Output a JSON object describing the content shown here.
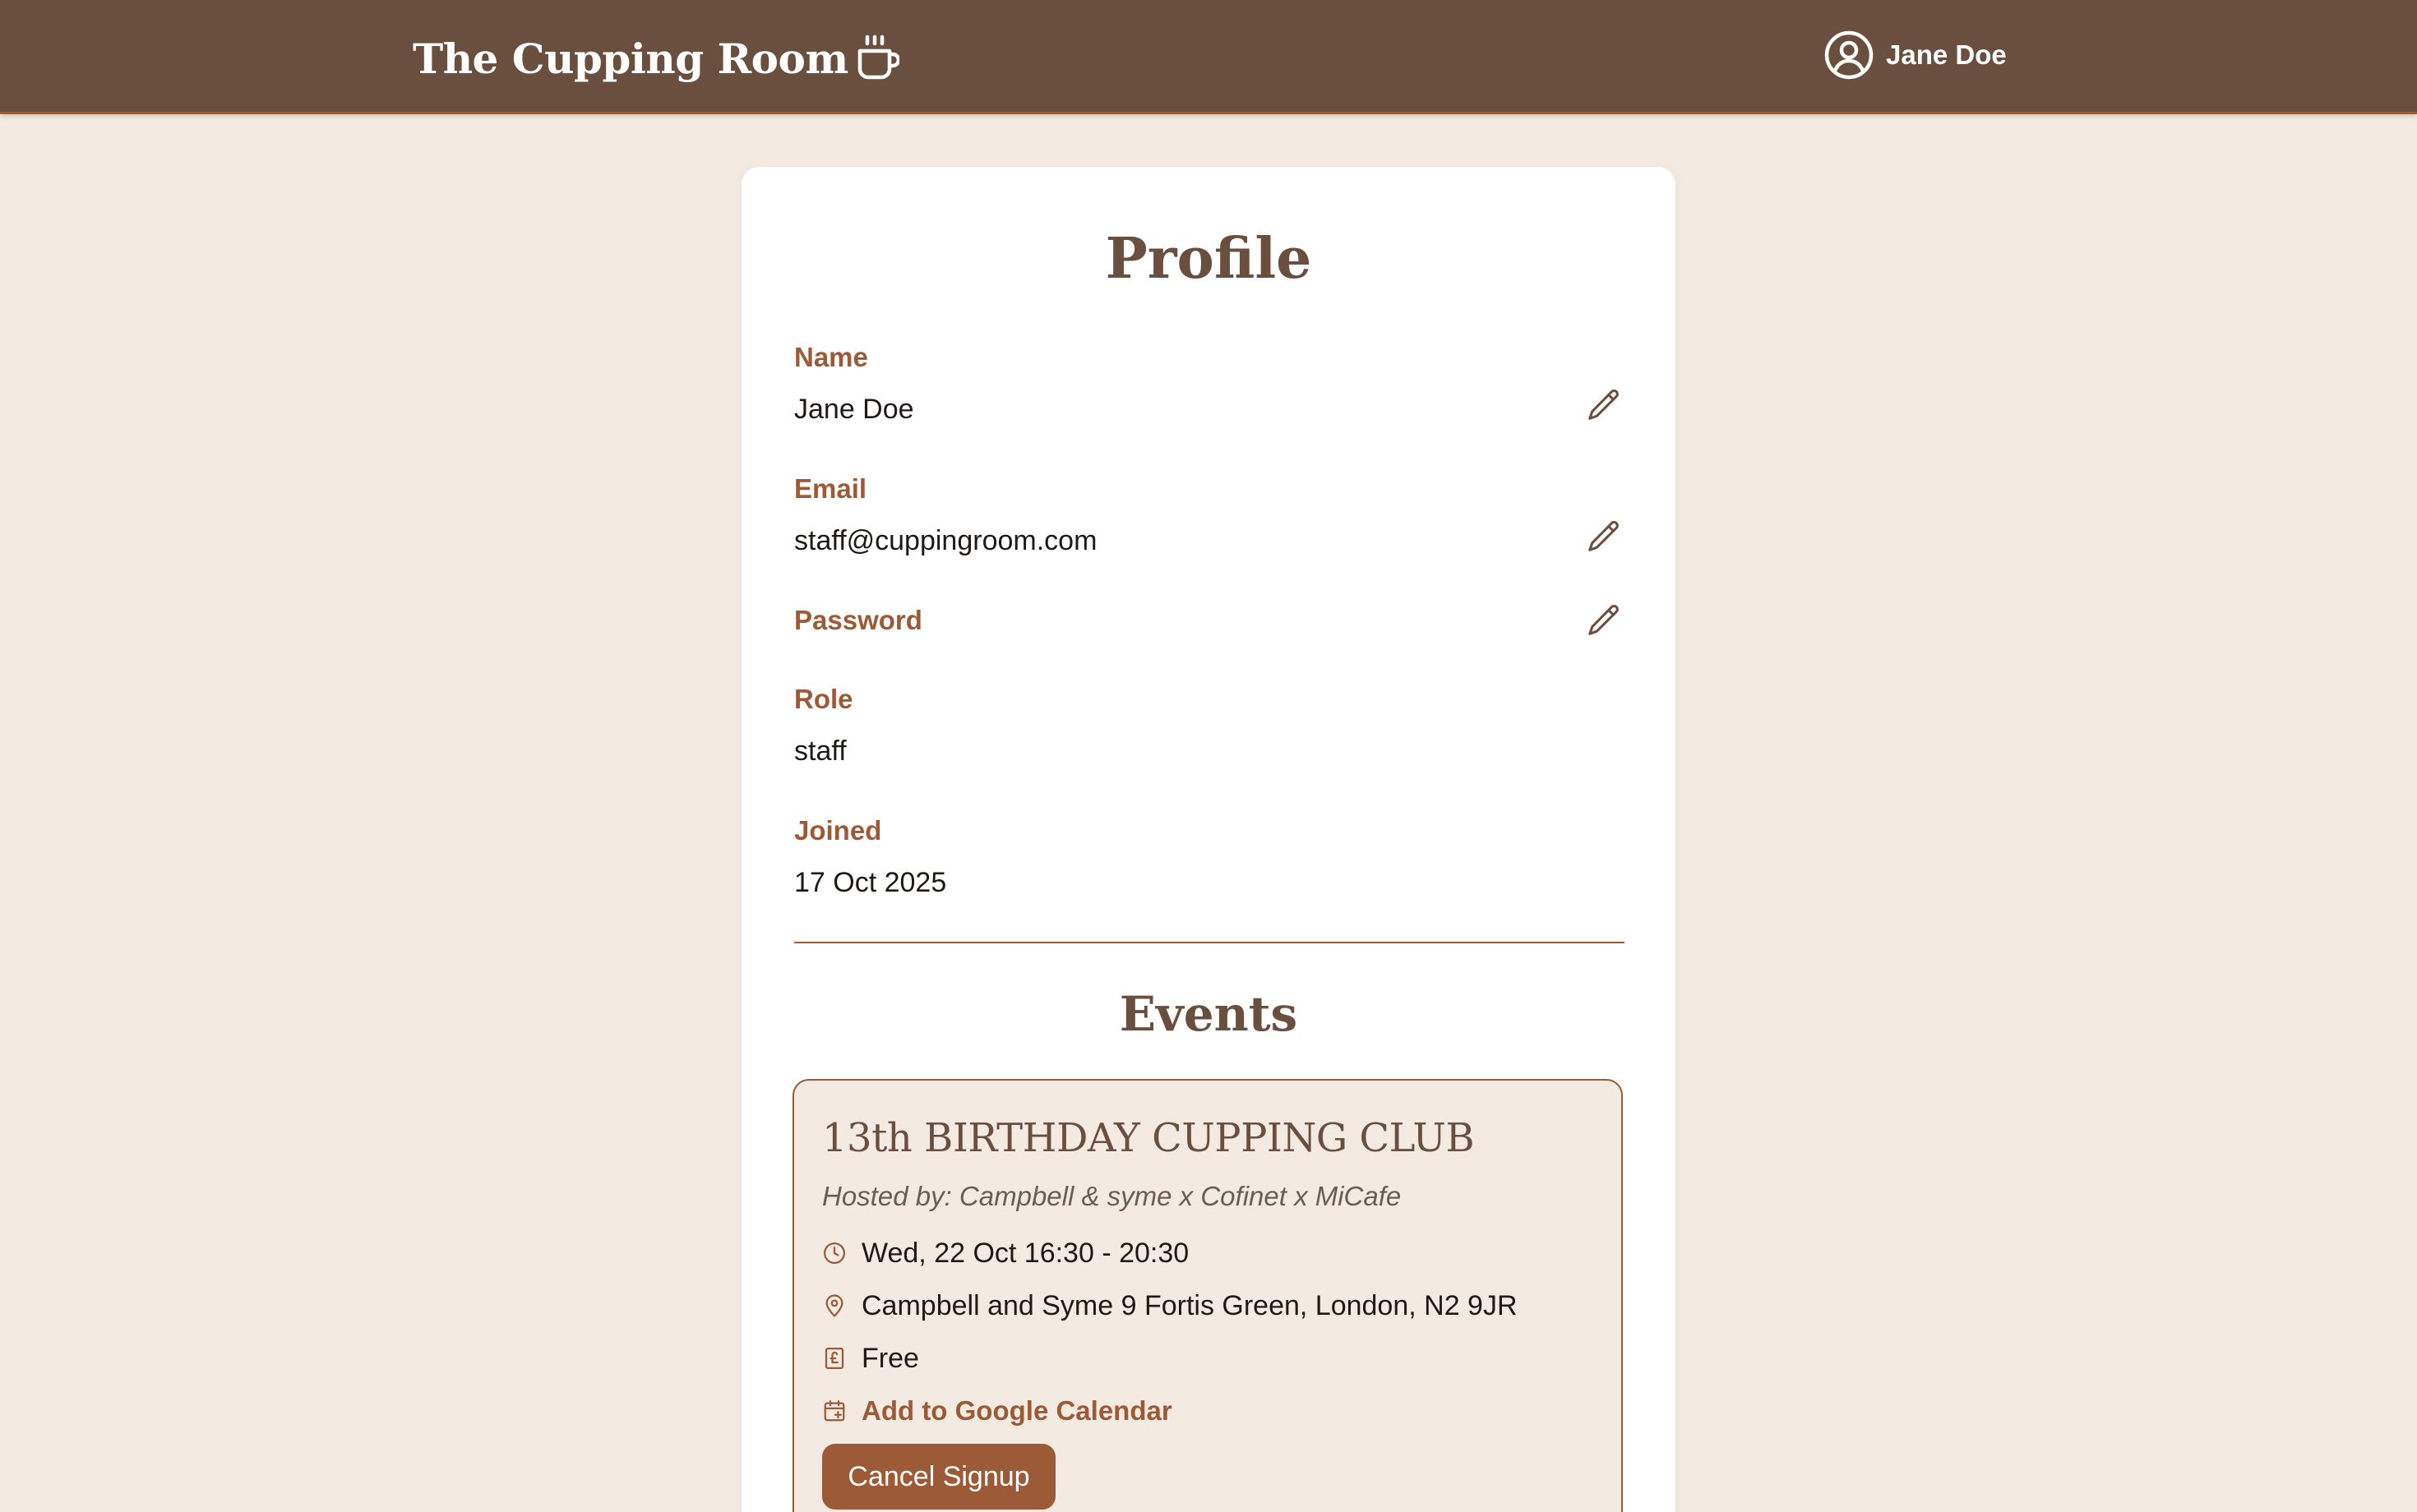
{
  "header": {
    "brand": "The Cupping Room",
    "user_name": "Jane Doe"
  },
  "profile": {
    "title": "Profile",
    "fields": {
      "name": {
        "label": "Name",
        "value": "Jane Doe"
      },
      "email": {
        "label": "Email",
        "value": "staff@cuppingroom.com"
      },
      "password": {
        "label": "Password"
      },
      "role": {
        "label": "Role",
        "value": "staff"
      },
      "joined": {
        "label": "Joined",
        "value": "17 Oct 2025"
      }
    }
  },
  "events": {
    "title": "Events",
    "items": [
      {
        "title": "13th BIRTHDAY CUPPING CLUB",
        "host": "Hosted by: Campbell & syme x Cofinet x MiCafe",
        "datetime": "Wed, 22 Oct 16:30 - 20:30",
        "location": "Campbell and Syme 9 Fortis Green, London, N2 9JR",
        "price": "Free",
        "calendar_link": "Add to Google Calendar",
        "cancel_label": "Cancel Signup"
      }
    ]
  },
  "colors": {
    "header_bg": "#6a4f3f",
    "accent": "#9d5a37",
    "page_bg": "#f3ebe2",
    "card_bg": "#ffffff"
  },
  "icons": {
    "brand": "coffee-cup-icon",
    "user": "user-circle-icon",
    "edit": "pencil-icon",
    "time": "clock-icon",
    "location": "map-pin-icon",
    "price": "pound-receipt-icon",
    "calendar": "calendar-plus-icon"
  }
}
